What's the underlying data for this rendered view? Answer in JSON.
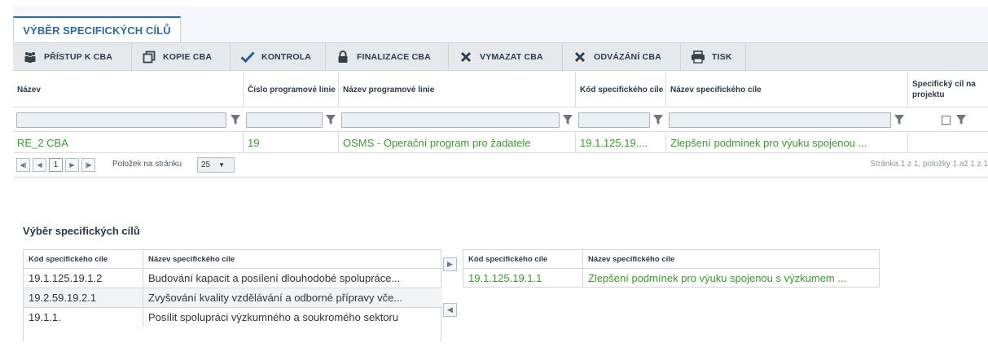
{
  "tab": {
    "label": "VÝBĚR SPECIFICKÝCH CÍLŮ"
  },
  "toolbar": [
    {
      "label": "PŘÍSTUP K CBA",
      "icon": "people-icon"
    },
    {
      "label": "KOPIE CBA",
      "icon": "copy-icon"
    },
    {
      "label": "KONTROLA",
      "icon": "check-icon"
    },
    {
      "label": "FINALIZACE CBA",
      "icon": "lock-icon"
    },
    {
      "label": "VYMAZAT CBA",
      "icon": "delete-icon"
    },
    {
      "label": "ODVÁZÁNÍ CBA",
      "icon": "unlink-icon"
    },
    {
      "label": "TISK",
      "icon": "print-icon"
    }
  ],
  "grid": {
    "columns": [
      "Název",
      "Číslo programové linie",
      "Název programové linie",
      "Kód specifického cíle",
      "Název specifického cíle",
      "Specifický cíl na projektu"
    ],
    "row": {
      "nazev": "RE_2 CBA",
      "cislo": "19",
      "nazev_linie": "OSMS - Operační program pro žadatele",
      "kod": "19.1.125.19....",
      "nazev_cile": "Zlepšení podmínek pro výuku spojenou ...",
      "na_projektu": ""
    },
    "pager": {
      "current_page": "1",
      "per_page_label": "Položek na stránku",
      "per_page_value": "25",
      "info": "Stránka 1 z 1, položky 1 až 1 z 1"
    }
  },
  "section": {
    "title": "Výběr specifických cílů"
  },
  "available": {
    "headers": [
      "Kód specifického cíle",
      "Název specifického cíle"
    ],
    "rows": [
      {
        "kod": "19.1.125.19.1.2",
        "nazev": "Budování kapacit a posílení dlouhodobé spolupráce..."
      },
      {
        "kod": "19.2.59.19.2.1",
        "nazev": "Zvyšování kvality vzdělávání a odborné přípravy vče..."
      },
      {
        "kod": "19.1.1.",
        "nazev": "Posílit spolupráci výzkumného a soukromého sektoru"
      }
    ]
  },
  "selected": {
    "headers": [
      "Kód specifického cíle",
      "Název specifického cíle"
    ],
    "rows": [
      {
        "kod": "19.1.125.19.1.1",
        "nazev": "Zlepšení podmínek pro výuku spojenou s výzkumem ..."
      }
    ]
  },
  "colors": {
    "accent": "#2c6aa0",
    "link_green": "#3b9a2e",
    "toolbar_bg": "#e6e9ec"
  }
}
